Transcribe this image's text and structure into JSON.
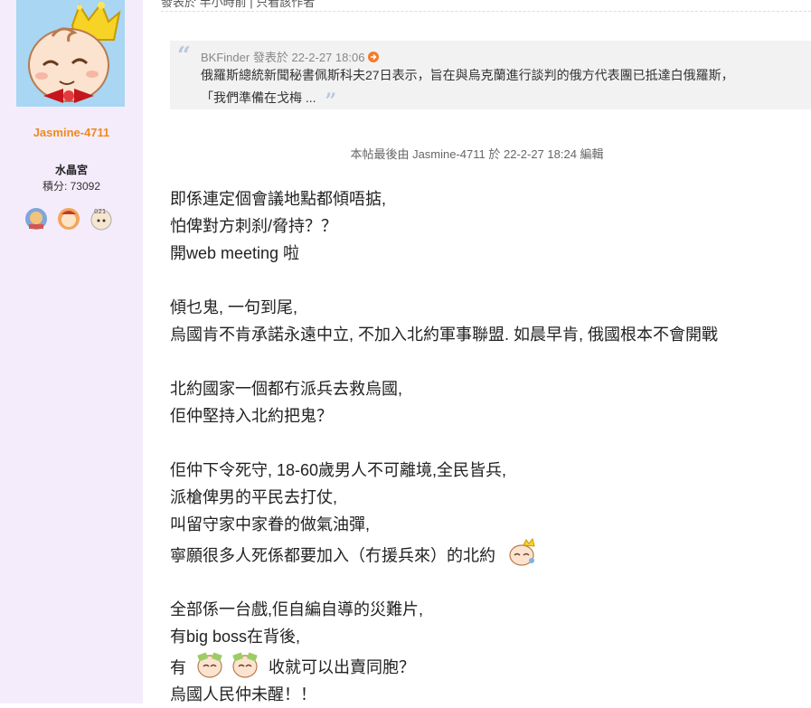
{
  "author": {
    "username": "Jasmine-4711",
    "group": "水晶宮",
    "points": "積分: 73092",
    "medals": [
      "medal-mascot-icon",
      "medal-character-icon",
      "medal-clock-icon"
    ]
  },
  "topbar": {
    "text": "發表於 半小時前 | 只看該作者"
  },
  "quote": {
    "author": "BKFinder",
    "posted_label": "發表於",
    "timestamp": "22-2-27 18:06",
    "line1": "俄羅斯總統新聞秘書佩斯科夫27日表示，旨在與烏克蘭進行談判的俄方代表團已抵達白俄羅斯，",
    "line2": "「我們準備在戈梅 ..."
  },
  "edit_note": "本帖最後由 Jasmine-4711 於 22-2-27 18:24 編輯",
  "post": {
    "p1": [
      "即係連定個會議地點都傾唔掂,",
      "怕俾對方刺刹/脅持？？",
      "開web meeting 啦"
    ],
    "p2": [
      "傾乜鬼, 一句到尾,",
      "烏國肯不肯承諾永遠中立, 不加入北約軍事聯盟. 如晨早肯, 俄國根本不會開戰"
    ],
    "p3": [
      "北約國家一個都冇派兵去救烏國,",
      "佢仲堅持入北約把鬼？"
    ],
    "p4": [
      "佢仲下令死守, 18-60歲男人不可離境,全民皆兵,",
      "派槍俾男的平民去打仗,",
      "叫留守家中家眷的做氣油彈,",
      "寧願很多人死係都要加入（冇援兵來）的北約"
    ],
    "p5_l1": "全部係一台戲,佢自編自導的災難片,",
    "p5_l2": "有big boss在背後,",
    "p5_l3a": "有",
    "p5_l3b": "收就可以出賣同胞？",
    "p5_l4": "烏國人民仲未醒！！"
  },
  "colors": {
    "sidebar_bg": "#f5ecfb",
    "username": "#f08a1c",
    "quote_bg": "#f2f2f2",
    "quote_mark": "#b9c8de"
  }
}
